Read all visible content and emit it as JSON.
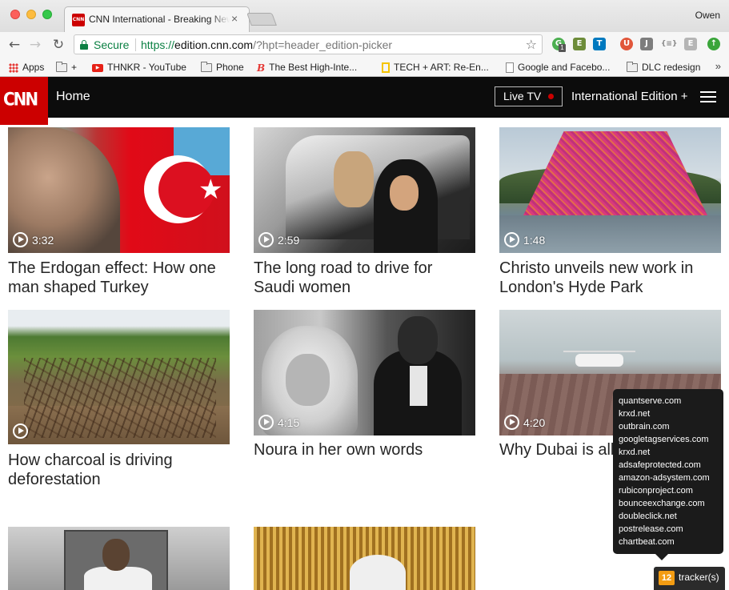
{
  "browser": {
    "tab_title": "CNN International - Breaking News",
    "tab_favicon_text": "CNN",
    "tab_close": "×",
    "profile_name": "Owen",
    "nav": {
      "back": "←",
      "forward": "→",
      "reload": "↻"
    },
    "omnibox": {
      "secure_label": "Secure",
      "url_protocol": "https://",
      "url_host": "edition.cnn.com",
      "url_path": "/?hpt=header_edition-picker"
    },
    "star": "☆",
    "extensions": [
      {
        "name": "ghostery-icon",
        "glyph": "G",
        "badge": "1"
      },
      {
        "name": "evernote-icon",
        "glyph": "E"
      },
      {
        "name": "trello-icon",
        "glyph": "T"
      },
      {
        "name": "ublock-icon",
        "glyph": "U"
      },
      {
        "name": "jsonview-icon",
        "glyph": "J"
      },
      {
        "name": "json-formatter-icon",
        "glyph": "{≡}"
      },
      {
        "name": "extension-e-icon",
        "glyph": "E"
      },
      {
        "name": "upload-icon",
        "glyph": "↑"
      }
    ],
    "bookmarks": [
      {
        "label": "Apps",
        "icon": "apps-grid-icon"
      },
      {
        "label": "+",
        "icon": "folder-icon"
      },
      {
        "label": "THNKR - YouTube",
        "icon": "youtube-icon"
      },
      {
        "label": "Phone",
        "icon": "folder-icon"
      },
      {
        "label": "The Best High-Inte...",
        "icon": "business-insider-icon"
      },
      {
        "label": "TECH + ART: Re-En...",
        "icon": "tech-art-icon"
      },
      {
        "label": "Google and Facebo...",
        "icon": "document-icon"
      },
      {
        "label": "DLC redesign",
        "icon": "folder-icon"
      }
    ],
    "bookmarks_more": "»"
  },
  "cnn": {
    "logo": "CNN",
    "home": "Home",
    "live_tv": "Live TV",
    "edition": "International Edition +",
    "brand_color": "#cc0000"
  },
  "cards": [
    {
      "headline": "The Erdogan effect: How one man shaped Turkey",
      "duration": "3:32"
    },
    {
      "headline": "The long road to drive for Saudi women",
      "duration": "2:59"
    },
    {
      "headline": "Christo unveils new work in London's Hyde Park",
      "duration": "1:48"
    },
    {
      "headline": "How charcoal is driving deforestation",
      "duration": ""
    },
    {
      "headline": "Noura in her own words",
      "duration": "4:15"
    },
    {
      "headline": "Why Dubai is all",
      "duration": "4:20"
    },
    {
      "headline": "",
      "duration": ""
    },
    {
      "headline": "",
      "duration": ""
    }
  ],
  "trackers": {
    "count": "12",
    "label": "tracker(s)",
    "domains": [
      "quantserve.com",
      "krxd.net",
      "outbrain.com",
      "googletagservices.com",
      "krxd.net",
      "adsafeprotected.com",
      "amazon-adsystem.com",
      "rubiconproject.com",
      "bounceexchange.com",
      "doubleclick.net",
      "postrelease.com",
      "chartbeat.com"
    ]
  }
}
